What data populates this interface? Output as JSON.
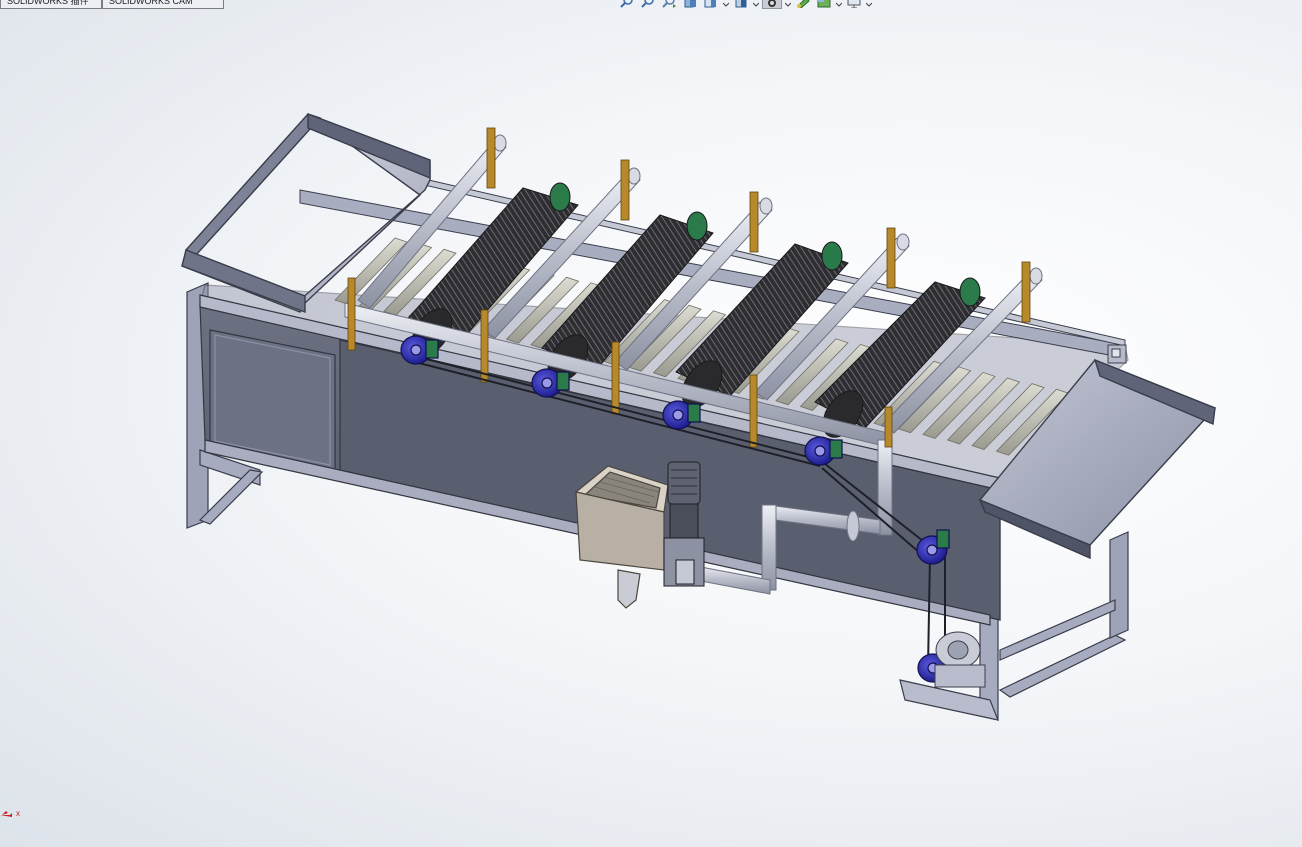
{
  "tabs": [
    {
      "label": "SOLIDWORKS 插件"
    },
    {
      "label": "SOLIDWORKS CAM"
    }
  ],
  "heads_up_toolbar": [
    {
      "icon": "zoom-to-fit-icon"
    },
    {
      "icon": "zoom-to-area-icon"
    },
    {
      "icon": "previous-view-icon"
    },
    {
      "icon": "section-view-icon"
    },
    {
      "icon": "view-orientation-icon"
    },
    {
      "icon": "display-style-icon"
    },
    {
      "icon": "hide-show-items-icon"
    },
    {
      "icon": "edit-appearance-icon"
    },
    {
      "icon": "apply-scene-icon"
    },
    {
      "icon": "view-settings-icon"
    }
  ],
  "triad": {
    "axis_label": "x"
  },
  "model": {
    "name": "brush-roller-washing-machine",
    "brush_count": 4,
    "colors": {
      "frame": "#9aa0b8",
      "tank": "#5f6474",
      "pipe": "#c9cdd8",
      "brush": "#3a3a3e",
      "pulley": "#2a2ab8",
      "bracket": "#b88a2a",
      "hopper": "#b8b0a4"
    }
  }
}
